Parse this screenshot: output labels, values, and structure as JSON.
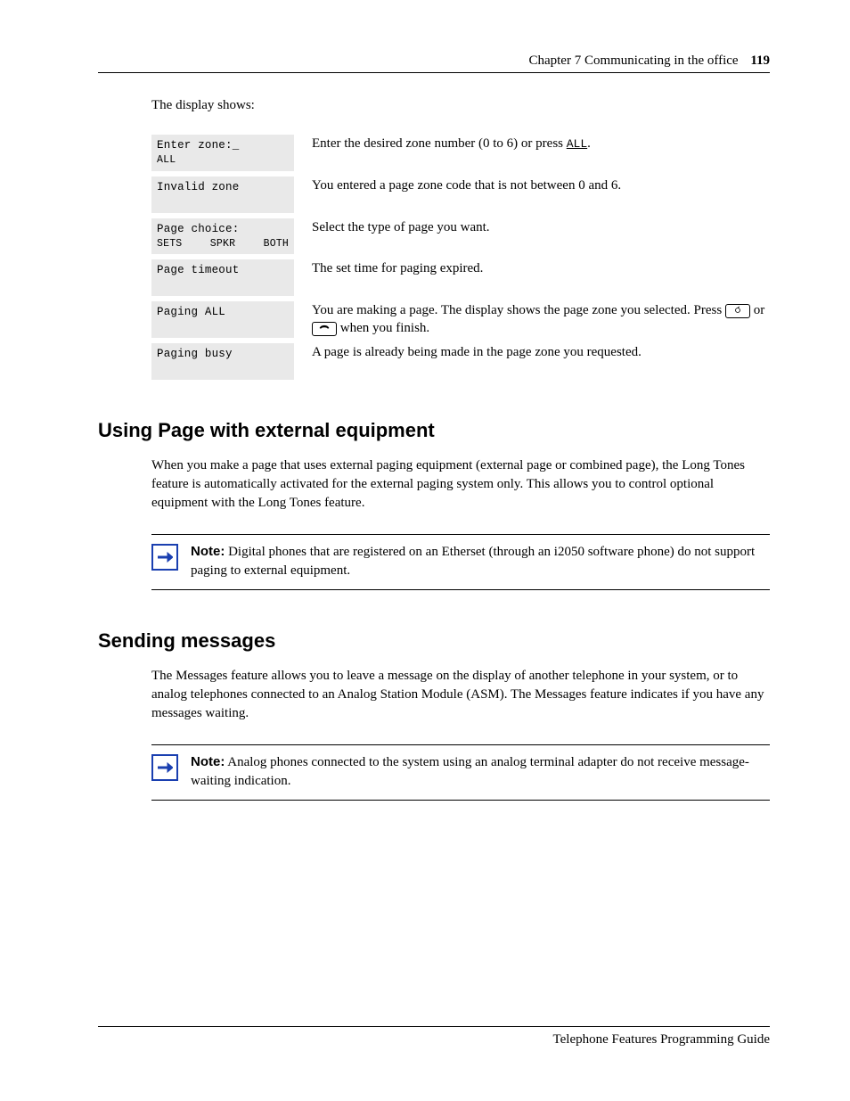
{
  "header": {
    "chapter": "Chapter 7",
    "title": "Communicating in the office",
    "page_number": "119"
  },
  "intro_line": "The display shows:",
  "rows": [
    {
      "lcd_line1": "Enter zone:_",
      "lcd_left": "ALL",
      "lcd_mid": "",
      "lcd_right": "",
      "desc_pre": "Enter the desired zone number (0 to 6) or press ",
      "desc_btn": "ALL",
      "desc_post": "."
    },
    {
      "lcd_line1": "Invalid zone",
      "desc": "You entered a page zone code that is not between 0 and 6."
    },
    {
      "lcd_line1": "Page choice:",
      "lcd_left": "SETS",
      "lcd_mid": "SPKR",
      "lcd_right": "BOTH",
      "desc": "Select the type of page you want."
    },
    {
      "lcd_line1": "Page timeout",
      "desc": "The set time for paging expired."
    },
    {
      "lcd_line1": "Paging ALL",
      "desc_pre": "You are making a page. The display shows the page zone you selected. Press ",
      "desc_mid": " or ",
      "desc_post": " when you finish."
    },
    {
      "lcd_line1": "Paging busy",
      "desc": "A page is already being made in the page zone you requested."
    }
  ],
  "section1": {
    "heading": "Using Page with external equipment",
    "para": "When you make a page that uses external paging equipment (external page or combined page), the Long Tones feature is automatically activated for the external paging system only. This allows you to control optional equipment with the Long Tones feature.",
    "note_label": "Note:",
    "note_text": "Digital phones that are registered on an Etherset (through an i2050 software phone) do not support paging to external equipment."
  },
  "section2": {
    "heading": "Sending messages",
    "para": "The Messages feature allows you to leave a message on the display of another telephone in your system, or to analog telephones connected to an Analog Station Module (ASM). The Messages feature indicates if you have any messages waiting.",
    "note_label": "Note:",
    "note_text": "Analog phones connected to the system using an analog terminal adapter do not receive message-waiting indication."
  },
  "footer_text": "Telephone Features Programming Guide"
}
